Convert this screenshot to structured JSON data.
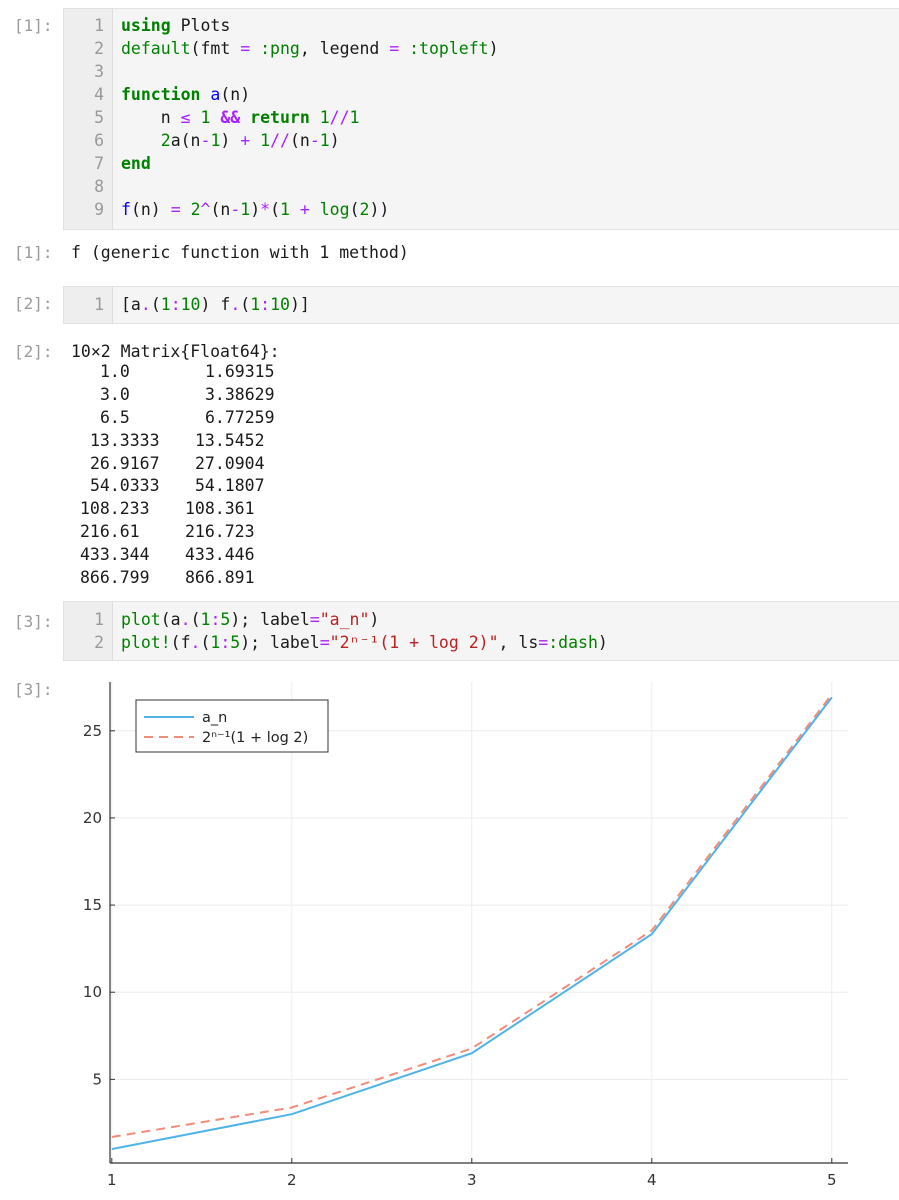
{
  "cells": [
    {
      "prompt": "[1]:",
      "lines": [
        "using Plots",
        "default(fmt = :png, legend = :topleft)",
        "",
        "function a(n)",
        "    n ≤ 1 && return 1//1",
        "    2a(n-1) + 1//(n-1)",
        "end",
        "",
        "f(n) = 2^(n-1)*(1 + log(2))"
      ],
      "output_prompt": "[1]:",
      "output": "f (generic function with 1 method)"
    },
    {
      "prompt": "[2]:",
      "lines": [
        "[a.(1:10) f.(1:10)]"
      ],
      "output_prompt": "[2]:",
      "output_header": "10×2 Matrix{Float64}:",
      "matrix": {
        "col1": [
          "1.0",
          "3.0",
          "6.5",
          "13.3333",
          "26.9167",
          "54.0333",
          "108.233",
          "216.61",
          "433.344",
          "866.799"
        ],
        "col2": [
          "1.69315",
          "3.38629",
          "6.77259",
          "13.5452",
          "27.0904",
          "54.1807",
          "108.361",
          "216.723",
          "433.446",
          "866.891"
        ]
      }
    },
    {
      "prompt": "[3]:",
      "lines": [
        "plot(a.(1:5); label=\"a_n\")",
        "plot!(f.(1:5); label=\"2ⁿ⁻¹(1 + log 2)\", ls=:dash)"
      ],
      "output_prompt": "[3]:"
    }
  ],
  "chart_data": {
    "type": "line",
    "x": [
      1,
      2,
      3,
      4,
      5
    ],
    "series": [
      {
        "name": "a_n",
        "values": [
          1.0,
          3.0,
          6.5,
          13.3333,
          26.9167
        ],
        "color": "#4fb3e8",
        "style": "solid"
      },
      {
        "name": "2ⁿ⁻¹(1 + log 2)",
        "values": [
          1.69315,
          3.38629,
          6.77259,
          13.5452,
          27.0904
        ],
        "color": "#f28c7a",
        "style": "dash"
      }
    ],
    "xticks": [
      "1",
      "2",
      "3",
      "4",
      "5"
    ],
    "yticks": [
      "5",
      "10",
      "15",
      "20",
      "25"
    ],
    "xlim": [
      0.99,
      5.09
    ],
    "ylim": [
      0.2,
      27.8
    ],
    "grid": true,
    "legend_position": "top-left"
  }
}
